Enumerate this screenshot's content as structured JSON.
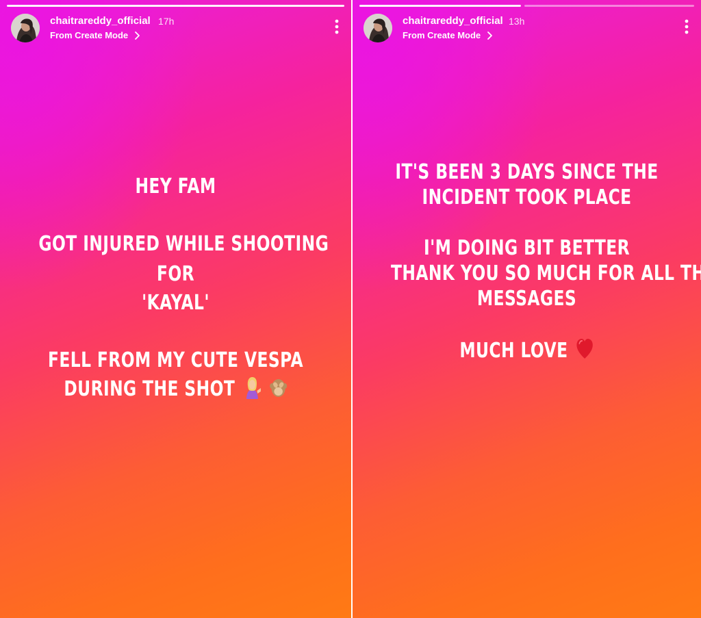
{
  "stories": [
    {
      "username": "chaitrareddy_official",
      "time": "17h",
      "subtitle": "From Create Mode",
      "lines": {
        "l1": "HEY FAM",
        "l2": "GOT INJURED WHILE SHOOTING",
        "l3": "FOR",
        "l4": "'KAYAL'",
        "l5": "FELL FROM MY CUTE VESPA",
        "l6": "DURING THE SHOT"
      },
      "emojis": [
        "woman-tipping-hand-emoji",
        "see-no-evil-monkey-emoji"
      ]
    },
    {
      "username": "chaitrareddy_official",
      "time": "13h",
      "subtitle": "From Create Mode",
      "lines": {
        "l1": "IT'S BEEN 3 DAYS SINCE THE",
        "l2": "INCIDENT TOOK PLACE",
        "l3": "I'M DOING BIT BETTER",
        "l4": "THANK YOU SO MUCH FOR ALL THE",
        "l5": "MESSAGES",
        "l6": "MUCH LOVE"
      },
      "emojis": [
        "red-heart-emoji"
      ]
    }
  ],
  "icons": {
    "more": "vertical-dots-icon",
    "chevron": "chevron-right-icon"
  },
  "colors": {
    "gradient_top": "#e91ce4",
    "gradient_mid": "#fb3b63",
    "gradient_bottom": "#ff7a14",
    "text": "#ffffff"
  }
}
